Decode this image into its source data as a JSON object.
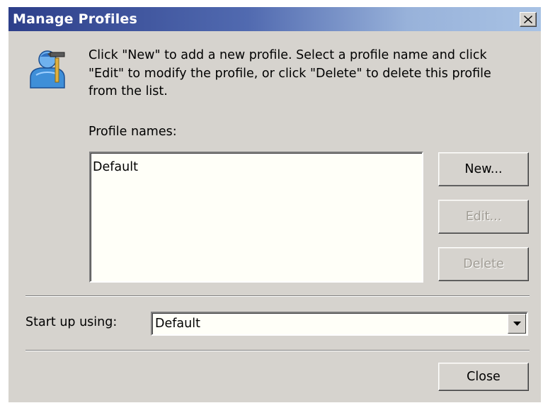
{
  "dialog": {
    "title": "Manage Profiles",
    "close_glyph": "✕"
  },
  "icon": {
    "name": "profile-tools-icon"
  },
  "instructions": "Click \"New\" to add a new profile.  Select a profile name and click\n\"Edit\" to modify the profile, or click \"Delete\" to delete this profile\nfrom the list.",
  "profiles": {
    "label": "Profile names:",
    "items": [
      "Default"
    ]
  },
  "buttons": {
    "new_label": "New...",
    "edit_label": "Edit...",
    "delete_label": "Delete",
    "close_label": "Close"
  },
  "startup": {
    "label": "Start up using:",
    "selected": "Default"
  },
  "colors": {
    "title_gradient_start": "#2d3f8a",
    "title_gradient_end": "#a8c2e4",
    "dialog_bg": "#d6d3ce",
    "field_bg": "#fffff8",
    "disabled_text": "#a09c94"
  }
}
